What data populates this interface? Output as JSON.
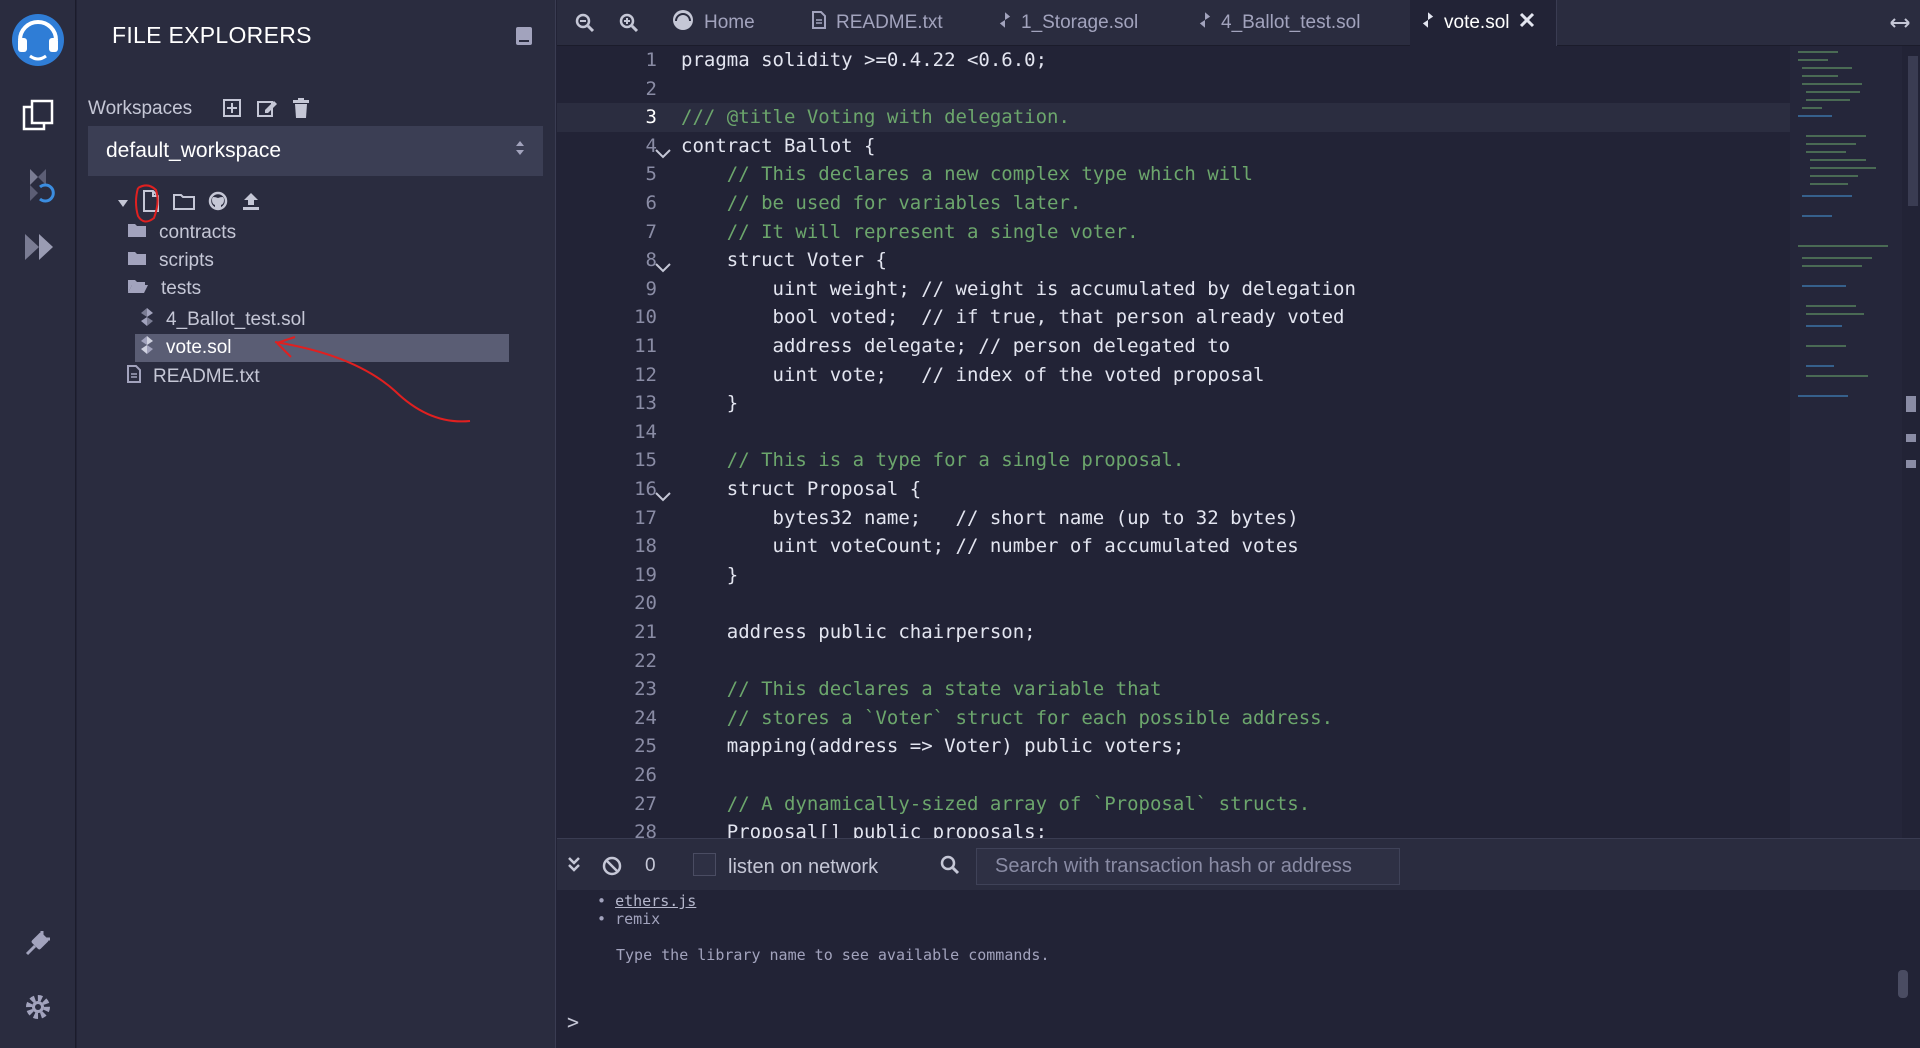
{
  "sidepanel": {
    "title": "FILE EXPLORERS",
    "workspaces_label": "Workspaces",
    "workspace_selected": "default_workspace",
    "tree": {
      "folders": [
        "contracts",
        "scripts",
        "tests"
      ],
      "test_files": [
        "4_Ballot_test.sol",
        "vote.sol"
      ],
      "root_files": [
        "README.txt"
      ]
    }
  },
  "tabs": [
    {
      "label": "Home"
    },
    {
      "label": "README.txt"
    },
    {
      "label": "1_Storage.sol"
    },
    {
      "label": "4_Ballot_test.sol"
    },
    {
      "label": "vote.sol"
    }
  ],
  "editor": {
    "current_line": 3,
    "line_numbers": [
      "1",
      "2",
      "3",
      "4",
      "5",
      "6",
      "7",
      "8",
      "9",
      "10",
      "11",
      "12",
      "13",
      "14",
      "15",
      "16",
      "17",
      "18",
      "19",
      "20",
      "21",
      "22",
      "23",
      "24",
      "25",
      "26",
      "27",
      "28"
    ],
    "lines": [
      "pragma solidity >=0.4.22 <0.6.0;",
      "",
      "/// @title Voting with delegation.",
      "contract Ballot {",
      "    // This declares a new complex type which will",
      "    // be used for variables later.",
      "    // It will represent a single voter.",
      "    struct Voter {",
      "        uint weight; // weight is accumulated by delegation",
      "        bool voted;  // if true, that person already voted",
      "        address delegate; // person delegated to",
      "        uint vote;   // index of the voted proposal",
      "    }",
      "",
      "    // This is a type for a single proposal.",
      "    struct Proposal {",
      "        bytes32 name;   // short name (up to 32 bytes)",
      "        uint voteCount; // number of accumulated votes",
      "    }",
      "",
      "    address public chairperson;",
      "",
      "    // This declares a state variable that",
      "    // stores a `Voter` struct for each possible address.",
      "    mapping(address => Voter) public voters;",
      "",
      "    // A dynamically-sized array of `Proposal` structs.",
      "    Proposal[] public proposals;"
    ]
  },
  "terminal": {
    "pending_count": "0",
    "listen_label": "listen on network",
    "search_placeholder": "Search with transaction hash or address",
    "output": {
      "lib1": "ethers.js",
      "lib2": "remix",
      "hint": "Type the library name to see available commands."
    },
    "prompt": ">"
  },
  "colors": {
    "background": "#222336",
    "panel": "#2a2c3f",
    "accent": "#4aa8f0",
    "comment": "#6ca66c",
    "annotation": "#e02020"
  }
}
